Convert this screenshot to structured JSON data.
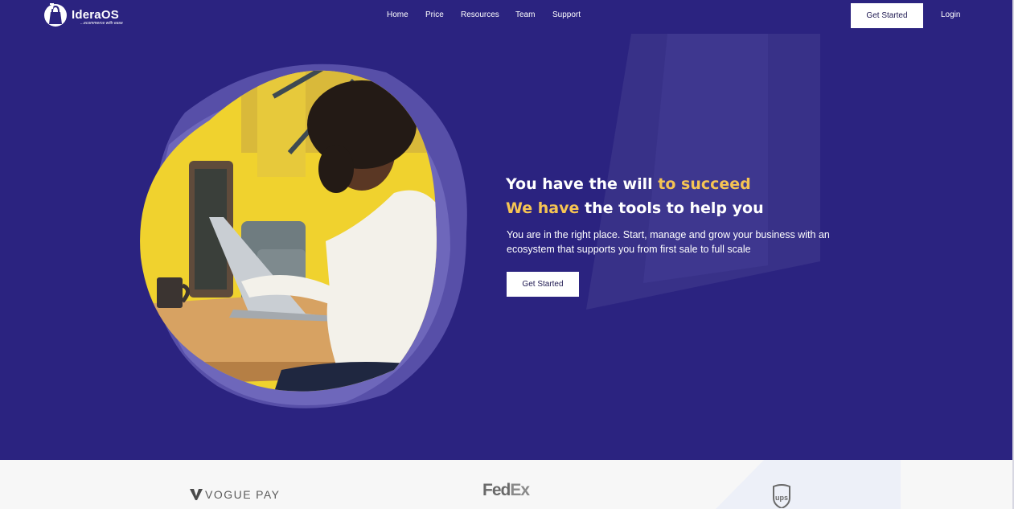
{
  "brand": {
    "name": "IderaOS",
    "tagline": "...ecommerce with ease"
  },
  "nav": {
    "links": [
      "Home",
      "Price",
      "Resources",
      "Team",
      "Support"
    ],
    "cta_label": "Get Started",
    "login_label": "Login"
  },
  "hero": {
    "line1_prefix": "You have the will ",
    "line1_accent": "to succeed",
    "line2_accent": "We have",
    "line2_suffix": " the tools to help you",
    "subtext": "You are in the right place. Start, manage and grow your business with an ecosystem that supports you from first sale to full scale",
    "cta_label": "Get Started"
  },
  "partners": {
    "vogue_word": "VOGUE",
    "vogue_pay": "PAY",
    "fedex_fed": "Fed",
    "fedex_ex": "Ex",
    "ups": "ups"
  },
  "colors": {
    "hero_bg": "#2b2380",
    "accent": "#f6c453",
    "text_light": "#ffffff",
    "partners_bg": "#f7f7f7"
  },
  "icons": [
    "shopping-bag-logo-icon",
    "vogue-pay-logo-icon",
    "ups-shield-logo-icon"
  ]
}
